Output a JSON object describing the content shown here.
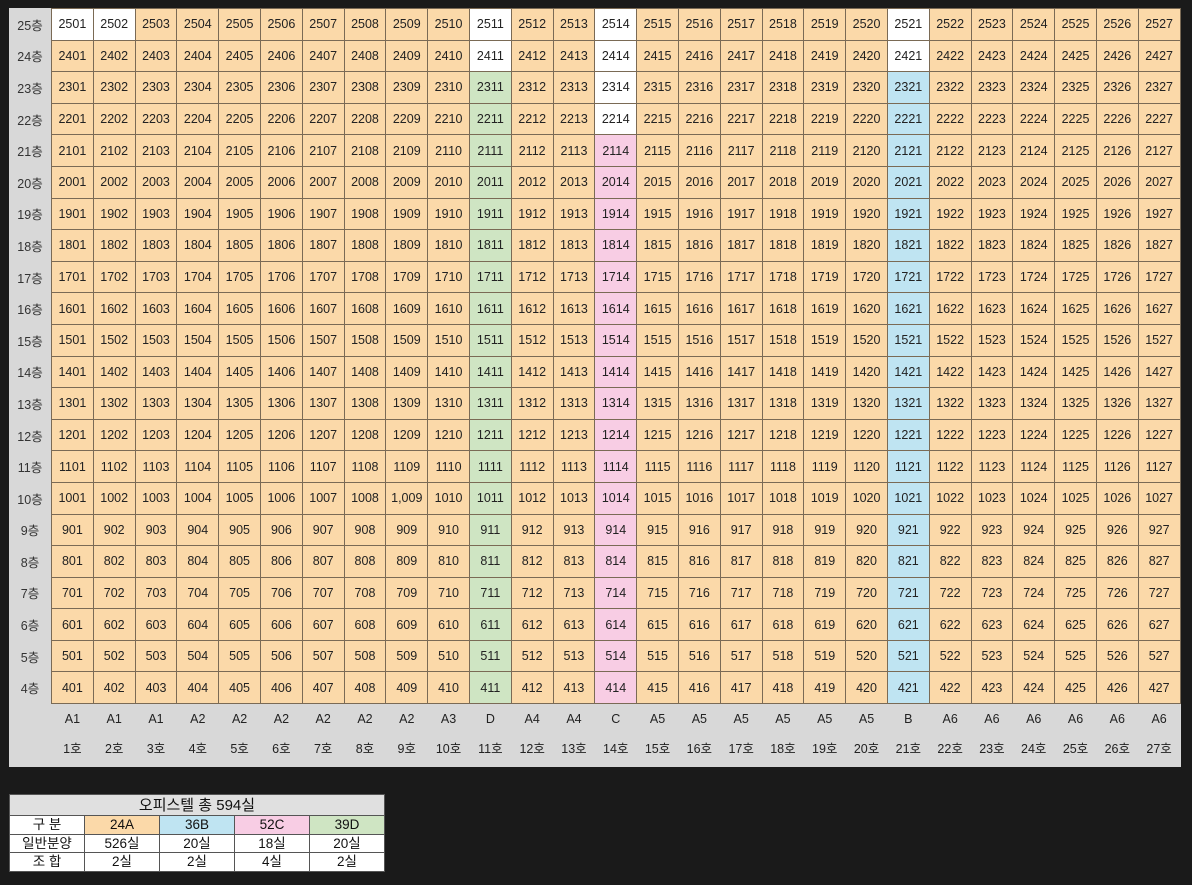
{
  "floors": [
    "25층",
    "24층",
    "23층",
    "22층",
    "21층",
    "20층",
    "19층",
    "18층",
    "17층",
    "16층",
    "15층",
    "14층",
    "13층",
    "12층",
    "11층",
    "10층",
    "9층",
    "8층",
    "7층",
    "6층",
    "5층",
    "4층"
  ],
  "rows": [
    [
      "2501",
      "2502",
      "2503",
      "2504",
      "2505",
      "2506",
      "2507",
      "2508",
      "2509",
      "2510",
      "2511",
      "2512",
      "2513",
      "2514",
      "2515",
      "2516",
      "2517",
      "2518",
      "2519",
      "2520",
      "2521",
      "2522",
      "2523",
      "2524",
      "2525",
      "2526",
      "2527"
    ],
    [
      "2401",
      "2402",
      "2403",
      "2404",
      "2405",
      "2406",
      "2407",
      "2408",
      "2409",
      "2410",
      "2411",
      "2412",
      "2413",
      "2414",
      "2415",
      "2416",
      "2417",
      "2418",
      "2419",
      "2420",
      "2421",
      "2422",
      "2423",
      "2424",
      "2425",
      "2426",
      "2427"
    ],
    [
      "2301",
      "2302",
      "2303",
      "2304",
      "2305",
      "2306",
      "2307",
      "2308",
      "2309",
      "2310",
      "2311",
      "2312",
      "2313",
      "2314",
      "2315",
      "2316",
      "2317",
      "2318",
      "2319",
      "2320",
      "2321",
      "2322",
      "2323",
      "2324",
      "2325",
      "2326",
      "2327"
    ],
    [
      "2201",
      "2202",
      "2203",
      "2204",
      "2205",
      "2206",
      "2207",
      "2208",
      "2209",
      "2210",
      "2211",
      "2212",
      "2213",
      "2214",
      "2215",
      "2216",
      "2217",
      "2218",
      "2219",
      "2220",
      "2221",
      "2222",
      "2223",
      "2224",
      "2225",
      "2226",
      "2227"
    ],
    [
      "2101",
      "2102",
      "2103",
      "2104",
      "2105",
      "2106",
      "2107",
      "2108",
      "2109",
      "2110",
      "2111",
      "2112",
      "2113",
      "2114",
      "2115",
      "2116",
      "2117",
      "2118",
      "2119",
      "2120",
      "2121",
      "2122",
      "2123",
      "2124",
      "2125",
      "2126",
      "2127"
    ],
    [
      "2001",
      "2002",
      "2003",
      "2004",
      "2005",
      "2006",
      "2007",
      "2008",
      "2009",
      "2010",
      "2011",
      "2012",
      "2013",
      "2014",
      "2015",
      "2016",
      "2017",
      "2018",
      "2019",
      "2020",
      "2021",
      "2022",
      "2023",
      "2024",
      "2025",
      "2026",
      "2027"
    ],
    [
      "1901",
      "1902",
      "1903",
      "1904",
      "1905",
      "1906",
      "1907",
      "1908",
      "1909",
      "1910",
      "1911",
      "1912",
      "1913",
      "1914",
      "1915",
      "1916",
      "1917",
      "1918",
      "1919",
      "1920",
      "1921",
      "1922",
      "1923",
      "1924",
      "1925",
      "1926",
      "1927"
    ],
    [
      "1801",
      "1802",
      "1803",
      "1804",
      "1805",
      "1806",
      "1807",
      "1808",
      "1809",
      "1810",
      "1811",
      "1812",
      "1813",
      "1814",
      "1815",
      "1816",
      "1817",
      "1818",
      "1819",
      "1820",
      "1821",
      "1822",
      "1823",
      "1824",
      "1825",
      "1826",
      "1827"
    ],
    [
      "1701",
      "1702",
      "1703",
      "1704",
      "1705",
      "1706",
      "1707",
      "1708",
      "1709",
      "1710",
      "1711",
      "1712",
      "1713",
      "1714",
      "1715",
      "1716",
      "1717",
      "1718",
      "1719",
      "1720",
      "1721",
      "1722",
      "1723",
      "1724",
      "1725",
      "1726",
      "1727"
    ],
    [
      "1601",
      "1602",
      "1603",
      "1604",
      "1605",
      "1606",
      "1607",
      "1608",
      "1609",
      "1610",
      "1611",
      "1612",
      "1613",
      "1614",
      "1615",
      "1616",
      "1617",
      "1618",
      "1619",
      "1620",
      "1621",
      "1622",
      "1623",
      "1624",
      "1625",
      "1626",
      "1627"
    ],
    [
      "1501",
      "1502",
      "1503",
      "1504",
      "1505",
      "1506",
      "1507",
      "1508",
      "1509",
      "1510",
      "1511",
      "1512",
      "1513",
      "1514",
      "1515",
      "1516",
      "1517",
      "1518",
      "1519",
      "1520",
      "1521",
      "1522",
      "1523",
      "1524",
      "1525",
      "1526",
      "1527"
    ],
    [
      "1401",
      "1402",
      "1403",
      "1404",
      "1405",
      "1406",
      "1407",
      "1408",
      "1409",
      "1410",
      "1411",
      "1412",
      "1413",
      "1414",
      "1415",
      "1416",
      "1417",
      "1418",
      "1419",
      "1420",
      "1421",
      "1422",
      "1423",
      "1424",
      "1425",
      "1426",
      "1427"
    ],
    [
      "1301",
      "1302",
      "1303",
      "1304",
      "1305",
      "1306",
      "1307",
      "1308",
      "1309",
      "1310",
      "1311",
      "1312",
      "1313",
      "1314",
      "1315",
      "1316",
      "1317",
      "1318",
      "1319",
      "1320",
      "1321",
      "1322",
      "1323",
      "1324",
      "1325",
      "1326",
      "1327"
    ],
    [
      "1201",
      "1202",
      "1203",
      "1204",
      "1205",
      "1206",
      "1207",
      "1208",
      "1209",
      "1210",
      "1211",
      "1212",
      "1213",
      "1214",
      "1215",
      "1216",
      "1217",
      "1218",
      "1219",
      "1220",
      "1221",
      "1222",
      "1223",
      "1224",
      "1225",
      "1226",
      "1227"
    ],
    [
      "1101",
      "1102",
      "1103",
      "1104",
      "1105",
      "1106",
      "1107",
      "1108",
      "1109",
      "1110",
      "1111",
      "1112",
      "1113",
      "1114",
      "1115",
      "1116",
      "1117",
      "1118",
      "1119",
      "1120",
      "1121",
      "1122",
      "1123",
      "1124",
      "1125",
      "1126",
      "1127"
    ],
    [
      "1001",
      "1002",
      "1003",
      "1004",
      "1005",
      "1006",
      "1007",
      "1008",
      "1,009",
      "1010",
      "1011",
      "1012",
      "1013",
      "1014",
      "1015",
      "1016",
      "1017",
      "1018",
      "1019",
      "1020",
      "1021",
      "1022",
      "1023",
      "1024",
      "1025",
      "1026",
      "1027"
    ],
    [
      "901",
      "902",
      "903",
      "904",
      "905",
      "906",
      "907",
      "908",
      "909",
      "910",
      "911",
      "912",
      "913",
      "914",
      "915",
      "916",
      "917",
      "918",
      "919",
      "920",
      "921",
      "922",
      "923",
      "924",
      "925",
      "926",
      "927"
    ],
    [
      "801",
      "802",
      "803",
      "804",
      "805",
      "806",
      "807",
      "808",
      "809",
      "810",
      "811",
      "812",
      "813",
      "814",
      "815",
      "816",
      "817",
      "818",
      "819",
      "820",
      "821",
      "822",
      "823",
      "824",
      "825",
      "826",
      "827"
    ],
    [
      "701",
      "702",
      "703",
      "704",
      "705",
      "706",
      "707",
      "708",
      "709",
      "710",
      "711",
      "712",
      "713",
      "714",
      "715",
      "716",
      "717",
      "718",
      "719",
      "720",
      "721",
      "722",
      "723",
      "724",
      "725",
      "726",
      "727"
    ],
    [
      "601",
      "602",
      "603",
      "604",
      "605",
      "606",
      "607",
      "608",
      "609",
      "610",
      "611",
      "612",
      "613",
      "614",
      "615",
      "616",
      "617",
      "618",
      "619",
      "620",
      "621",
      "622",
      "623",
      "624",
      "625",
      "626",
      "627"
    ],
    [
      "501",
      "502",
      "503",
      "504",
      "505",
      "506",
      "507",
      "508",
      "509",
      "510",
      "511",
      "512",
      "513",
      "514",
      "515",
      "516",
      "517",
      "518",
      "519",
      "520",
      "521",
      "522",
      "523",
      "524",
      "525",
      "526",
      "527"
    ],
    [
      "401",
      "402",
      "403",
      "404",
      "405",
      "406",
      "407",
      "408",
      "409",
      "410",
      "411",
      "412",
      "413",
      "414",
      "415",
      "416",
      "417",
      "418",
      "419",
      "420",
      "421",
      "422",
      "423",
      "424",
      "425",
      "426",
      "427"
    ]
  ],
  "unit_types": [
    "A1",
    "A1",
    "A1",
    "A2",
    "A2",
    "A2",
    "A2",
    "A2",
    "A2",
    "A3",
    "D",
    "A4",
    "A4",
    "C",
    "A5",
    "A5",
    "A5",
    "A5",
    "A5",
    "A5",
    "B",
    "A6",
    "A6",
    "A6",
    "A6",
    "A6",
    "A6"
  ],
  "line_numbers": [
    "1호",
    "2호",
    "3호",
    "4호",
    "5호",
    "6호",
    "7호",
    "8호",
    "9호",
    "10호",
    "11호",
    "12호",
    "13호",
    "14호",
    "15호",
    "16호",
    "17호",
    "18호",
    "19호",
    "20호",
    "21호",
    "22호",
    "23호",
    "24호",
    "25호",
    "26호",
    "27호"
  ],
  "colors": {
    "24A": "#fbd9a9",
    "36B": "#bfe4f2",
    "52C": "#f8cde4",
    "39D": "#cfe5c3",
    "unassigned": "#ffffff"
  },
  "summary": {
    "title": "오피스텔 총 594실",
    "row_labels": {
      "category": "구  분",
      "general": "일반분양",
      "union": "조  합"
    },
    "types": [
      "24A",
      "36B",
      "52C",
      "39D"
    ],
    "general": [
      "526실",
      "20실",
      "18실",
      "20실"
    ],
    "union": [
      "2실",
      "2실",
      "4실",
      "2실"
    ]
  }
}
